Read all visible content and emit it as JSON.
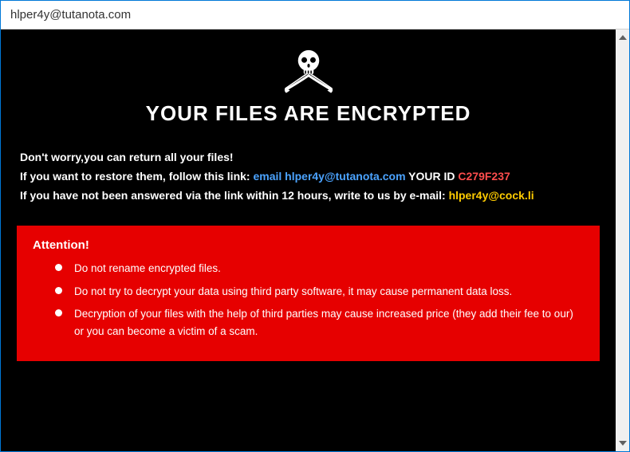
{
  "titlebar": {
    "title": "hlper4y@tutanota.com"
  },
  "heading": "YOUR FILES ARE ENCRYPTED",
  "info": {
    "line1": "Don't worry,you can return all your files!",
    "line2_prefix": "If you want to restore them, follow this link: ",
    "email_label": "email ",
    "email": "hlper4y@tutanota.com",
    "your_id_label": "  YOUR ID ",
    "your_id": "C279F237",
    "line3_prefix": "If you have not been answered via the link within 12 hours, write to us by e-mail: ",
    "alt_email": "hlper4y@cock.li"
  },
  "attention": {
    "title": "Attention!",
    "bullets": [
      "Do not rename encrypted files.",
      "Do not try to decrypt your data using third party software, it may cause permanent data loss.",
      "Decryption of your files with the help of third parties may cause increased price (they add their fee to our) or you can become a victim of a scam."
    ]
  }
}
